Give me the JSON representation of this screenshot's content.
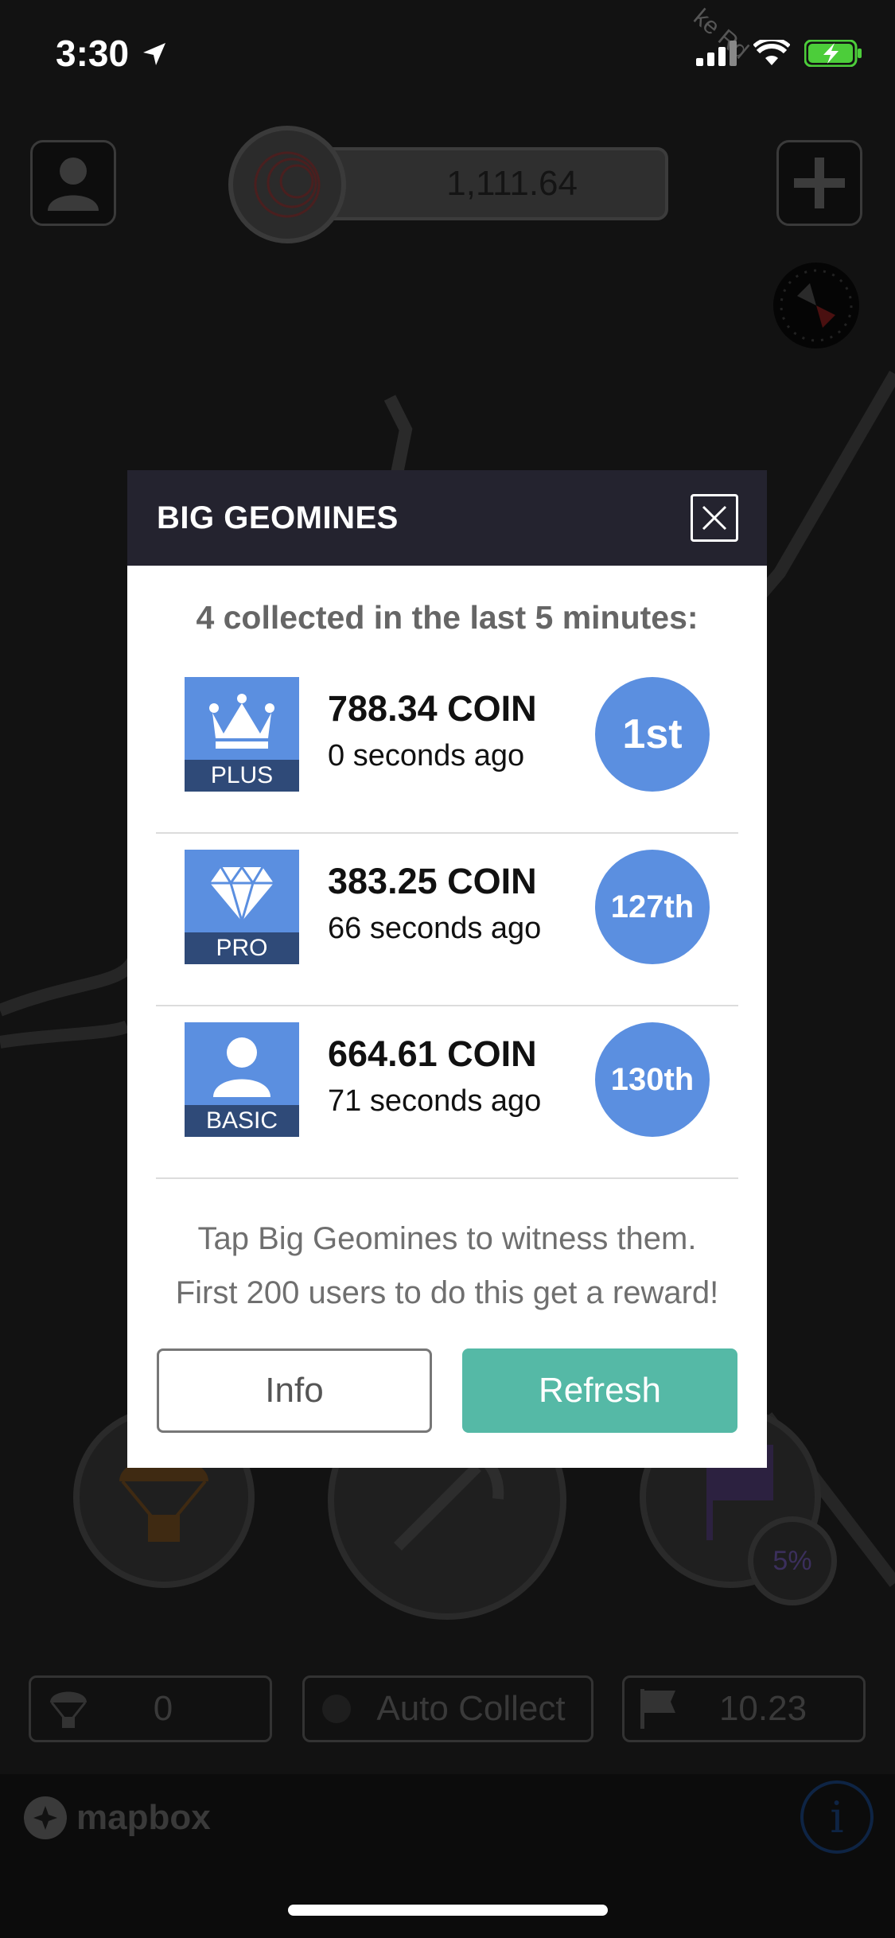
{
  "status_bar": {
    "time": "3:30"
  },
  "top_bar": {
    "balance": "1,111.64"
  },
  "map": {
    "street_label": "ke Rd"
  },
  "modal": {
    "title": "BIG GEOMINES",
    "subtitle": "4 collected in the last 5 minutes:",
    "items": [
      {
        "tier": "PLUS",
        "icon": "crown-icon",
        "amount": "788.34 COIN",
        "ago": "0 seconds ago",
        "rank": "1st"
      },
      {
        "tier": "PRO",
        "icon": "diamond-icon",
        "amount": "383.25 COIN",
        "ago": "66 seconds ago",
        "rank": "127th"
      },
      {
        "tier": "BASIC",
        "icon": "person-icon",
        "amount": "664.61 COIN",
        "ago": "71 seconds ago",
        "rank": "130th"
      }
    ],
    "footnote_line1": "Tap Big Geomines to witness them.",
    "footnote_line2": "First 200 users to do this get a reward!",
    "info_label": "Info",
    "refresh_label": "Refresh"
  },
  "bottom": {
    "airdrop_count": "0",
    "auto_collect_label": "Auto Collect",
    "flag_value": "10.23",
    "flag_percent": "5%",
    "attribution": "mapbox"
  },
  "colors": {
    "accent_blue": "#5b8fe0",
    "refresh_green": "#55b9a6",
    "header_dark": "#24232f"
  }
}
